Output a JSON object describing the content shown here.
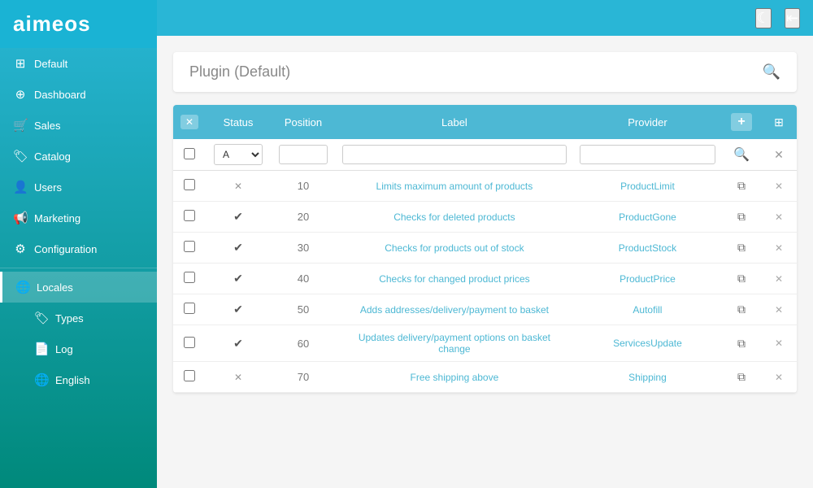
{
  "logo": {
    "text": "aimeos"
  },
  "topbar": {
    "moon_icon": "☾",
    "logout_icon": "⇥"
  },
  "sidebar": {
    "items": [
      {
        "id": "default",
        "label": "Default",
        "icon": "☰"
      },
      {
        "id": "dashboard",
        "label": "Dashboard",
        "icon": "🏠"
      },
      {
        "id": "sales",
        "label": "Sales",
        "icon": "🛒"
      },
      {
        "id": "catalog",
        "label": "Catalog",
        "icon": "🏷"
      },
      {
        "id": "users",
        "label": "Users",
        "icon": "👤"
      },
      {
        "id": "marketing",
        "label": "Marketing",
        "icon": "📢"
      },
      {
        "id": "configuration",
        "label": "Configuration",
        "icon": "⚙"
      },
      {
        "id": "locales",
        "label": "Locales",
        "icon": "🌐",
        "active": true
      },
      {
        "id": "types",
        "label": "Types",
        "icon": "🏷"
      },
      {
        "id": "log",
        "label": "Log",
        "icon": "📄"
      },
      {
        "id": "english",
        "label": "English",
        "icon": "🌐"
      }
    ]
  },
  "plugin_header": {
    "title": "Plugin",
    "subtitle": "(Default)"
  },
  "table": {
    "headers": [
      {
        "id": "close",
        "label": "✕"
      },
      {
        "id": "status",
        "label": "Status"
      },
      {
        "id": "position",
        "label": "Position"
      },
      {
        "id": "label",
        "label": "Label"
      },
      {
        "id": "provider",
        "label": "Provider"
      },
      {
        "id": "add",
        "label": "+"
      },
      {
        "id": "cols",
        "label": "⊞"
      }
    ],
    "filter": {
      "status_value": "A",
      "position_placeholder": "",
      "label_placeholder": "",
      "provider_placeholder": ""
    },
    "rows": [
      {
        "status": "cross",
        "position": "10",
        "label": "Limits maximum amount of products",
        "provider": "ProductLimit",
        "checked": false
      },
      {
        "status": "check",
        "position": "20",
        "label": "Checks for deleted products",
        "provider": "ProductGone",
        "checked": false
      },
      {
        "status": "check",
        "position": "30",
        "label": "Checks for products out of stock",
        "provider": "ProductStock",
        "checked": false
      },
      {
        "status": "check",
        "position": "40",
        "label": "Checks for changed product prices",
        "provider": "ProductPrice",
        "checked": false
      },
      {
        "status": "check",
        "position": "50",
        "label": "Adds addresses/delivery/payment to basket",
        "provider": "Autofill",
        "checked": false
      },
      {
        "status": "check",
        "position": "60",
        "label": "Updates delivery/payment options on basket change",
        "provider": "ServicesUpdate",
        "checked": false
      },
      {
        "status": "cross",
        "position": "70",
        "label": "Free shipping above",
        "provider": "Shipping",
        "checked": false
      }
    ]
  }
}
